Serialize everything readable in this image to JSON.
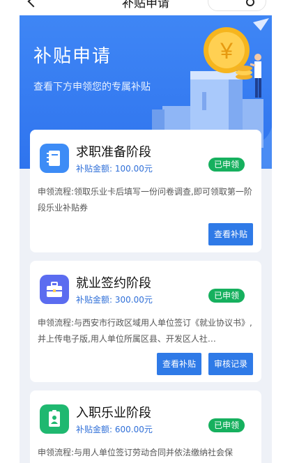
{
  "nav": {
    "title": "补贴申请"
  },
  "hero": {
    "title": "补贴申请",
    "subtitle": "查看下方申领您的专属补贴"
  },
  "cards": [
    {
      "title": "求职准备阶段",
      "amount_label": "补贴金额:",
      "amount": "100.00元",
      "status": "已申领",
      "desc": "申领流程:领取乐业卡后填写一份问卷调查,即可领取第一阶段乐业补贴券",
      "buttons": [
        "查看补贴"
      ],
      "icon": "notebook-icon",
      "color": "#3d8cf6"
    },
    {
      "title": "就业签约阶段",
      "amount_label": "补贴金额:",
      "amount": "300.00元",
      "status": "已申领",
      "desc": "申领流程:与西安市行政区域用人单位签订《就业协议书》,并上传电子版,用人单位所属区县、开发区人社…",
      "buttons": [
        "查看补贴",
        "审核记录"
      ],
      "icon": "briefcase-icon",
      "color": "#5b6cf0"
    },
    {
      "title": "入职乐业阶段",
      "amount_label": "补贴金额:",
      "amount": "600.00元",
      "status": "已申领",
      "desc": "申领流程:与用人单位签订劳动合同并依法缴纳社会保",
      "buttons": [],
      "icon": "id-badge-icon",
      "color": "#1fb870"
    }
  ],
  "colors": {
    "primary": "#2f7ae7",
    "badge_green": "#16b05e",
    "page_bg": "#eef1f7"
  }
}
